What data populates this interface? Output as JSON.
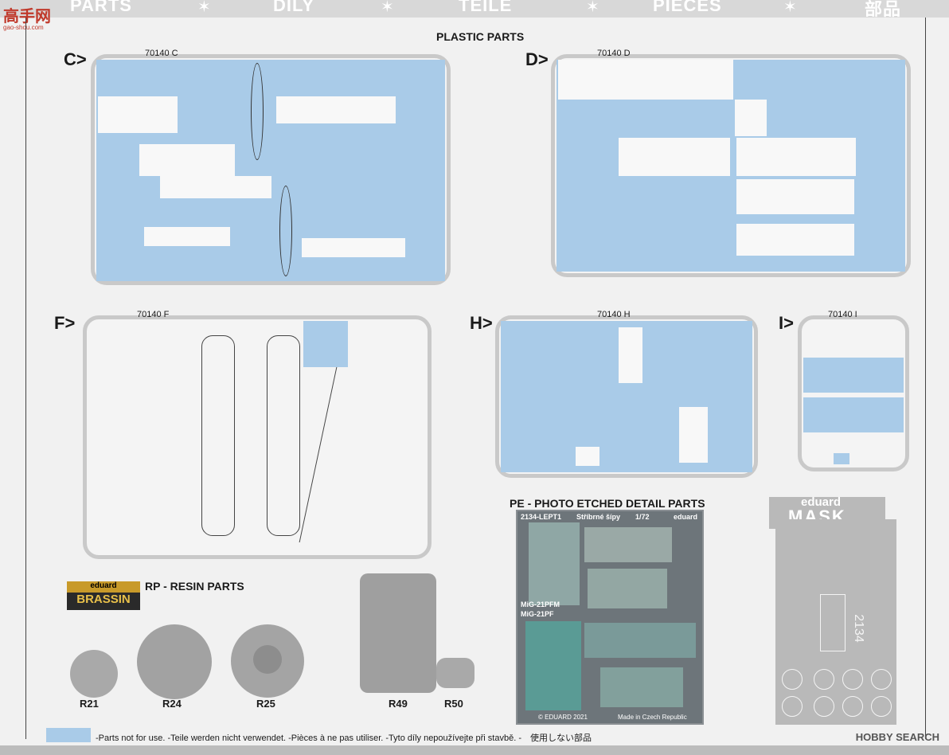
{
  "header": {
    "words": [
      "PARTS",
      "DILY",
      "TEILE",
      "PIÈCES",
      "部品"
    ],
    "site_logo": "高手网",
    "site_sub": "gao-shou.com"
  },
  "sections": {
    "plastic_title": "PLASTIC PARTS",
    "pe_title": "PE - PHOTO ETCHED DETAIL PARTS",
    "resin_title": "RP - RESIN PARTS"
  },
  "sprues": [
    {
      "letter": "C>",
      "code": "70140 C"
    },
    {
      "letter": "D>",
      "code": "70140 D"
    },
    {
      "letter": "F>",
      "code": "70140 F"
    },
    {
      "letter": "H>",
      "code": "70140 H"
    },
    {
      "letter": "I>",
      "code": "70140 I"
    }
  ],
  "pe_fret": {
    "code": "2134-LEPT1",
    "name": "Stříbrné šípy",
    "scale": "1/72",
    "brand": "eduard",
    "variant_a": "MiG-21PFM",
    "variant_b": "MiG-21PF",
    "copyright": "© EDUARD 2021",
    "origin": "Made in Czech Republic"
  },
  "mask": {
    "brand": "eduard",
    "title": "MASK",
    "number": "2134"
  },
  "brassin": {
    "brand": "eduard",
    "name": "BRASSIN"
  },
  "resin_parts": [
    "R21",
    "R24",
    "R25",
    "R49",
    "R50"
  ],
  "legend": "-Parts not for use. -Teile werden nicht verwendet. -Pièces à ne pas utiliser. -Tyto díly nepoužívejte při stavbě. -　使用しない部品",
  "watermark": "HOBBY SEARCH",
  "colors": {
    "unused_parts": "#a9cbe8",
    "sprue_frame": "#c9c9c9",
    "pe_fret": "#6d757a",
    "brassin_gold": "#c89a2a"
  }
}
